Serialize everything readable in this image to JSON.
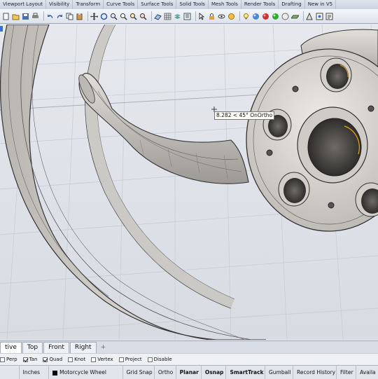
{
  "tabs": [
    "Viewport Layout",
    "Visibility",
    "Transform",
    "Curve Tools",
    "Surface Tools",
    "Solid Tools",
    "Mesh Tools",
    "Render Tools",
    "Drafting",
    "New in V5"
  ],
  "toolbar_icons": [
    "new-file",
    "open-file",
    "save",
    "print",
    "undo",
    "redo",
    "copy",
    "paste",
    "pan",
    "rotate-view",
    "zoom",
    "zoom-window",
    "zoom-extents",
    "zoom-selected",
    "cplane",
    "grid",
    "layer",
    "properties",
    "select",
    "lock",
    "hide",
    "show",
    "lights",
    "render",
    "materials",
    "color",
    "environment",
    "ground-plane",
    "analyze",
    "osnap",
    "history"
  ],
  "viewport": {
    "readout": "8.282 < 45° OnOrtho"
  },
  "viewport_tabs": [
    "tive",
    "Top",
    "Front",
    "Right"
  ],
  "viewport_add": "+",
  "osnap": [
    {
      "label": "Perp",
      "checked": false
    },
    {
      "label": "Tan",
      "checked": true
    },
    {
      "label": "Quad",
      "checked": true
    },
    {
      "label": "Knot",
      "checked": false
    },
    {
      "label": "Vertex",
      "checked": false
    },
    {
      "label": "Project",
      "checked": false
    },
    {
      "label": "Disable",
      "checked": false
    }
  ],
  "status": {
    "units": "Inches",
    "layer": "Motorcycle Wheel",
    "grid_snap": "Grid Snap",
    "ortho": "Ortho",
    "planar": "Planar",
    "osnap": "Osnap",
    "smarttrack": "SmartTrack",
    "gumball": "Gumball",
    "record_history": "Record History",
    "filter": "Filter",
    "available": "Availa"
  },
  "colors": {
    "accent": "#3a6fd6",
    "highlight_edge": "#e8a020"
  }
}
